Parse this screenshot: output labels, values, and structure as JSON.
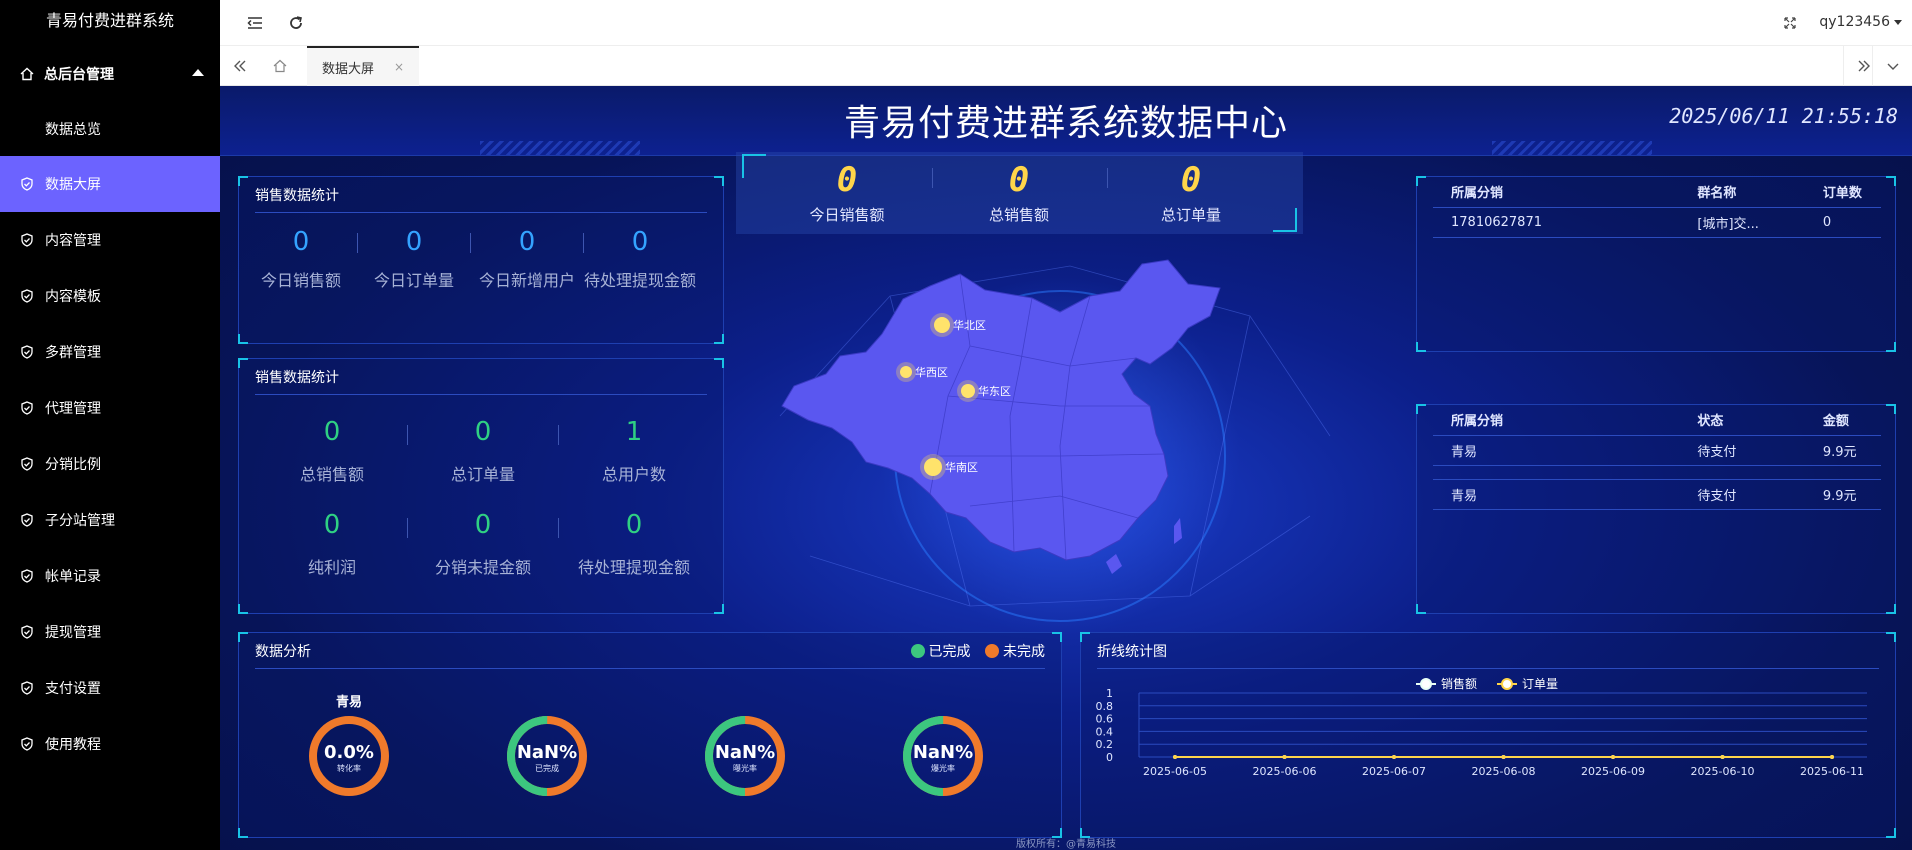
{
  "app": {
    "title": "青易付费进群系统",
    "user": "qy123456"
  },
  "sidebar": {
    "group": "总后台管理",
    "sub": "数据总览",
    "items": [
      {
        "label": "数据大屏",
        "active": true
      },
      {
        "label": "内容管理"
      },
      {
        "label": "内容模板"
      },
      {
        "label": "多群管理"
      },
      {
        "label": "代理管理"
      },
      {
        "label": "分销比例"
      },
      {
        "label": "子分站管理"
      },
      {
        "label": "帐单记录"
      },
      {
        "label": "提现管理"
      },
      {
        "label": "支付设置"
      },
      {
        "label": "使用教程"
      }
    ]
  },
  "tabs": [
    {
      "label": "数据大屏",
      "close": "×"
    }
  ],
  "dashboard": {
    "title": "青易付费进群系统数据中心",
    "datetime": "2025/06/11 21:55:18",
    "sales_panel_1": {
      "title": "销售数据统计",
      "stats": [
        {
          "value": "0",
          "label": "今日销售额"
        },
        {
          "value": "0",
          "label": "今日订单量"
        },
        {
          "value": "0",
          "label": "今日新增用户"
        },
        {
          "value": "0",
          "label": "待处理提现金额"
        }
      ]
    },
    "sales_panel_2": {
      "title": "销售数据统计",
      "stats": [
        {
          "value": "0",
          "label": "总销售额"
        },
        {
          "value": "0",
          "label": "总订单量"
        },
        {
          "value": "1",
          "label": "总用户数"
        },
        {
          "value": "0",
          "label": "纯利润"
        },
        {
          "value": "0",
          "label": "分销未提金额"
        },
        {
          "value": "0",
          "label": "待处理提现金额"
        }
      ]
    },
    "kpis": [
      {
        "value": "0",
        "label": "今日销售额"
      },
      {
        "value": "0",
        "label": "总销售额"
      },
      {
        "value": "0",
        "label": "总订单量"
      }
    ],
    "map": {
      "regions": [
        {
          "label": "华北区"
        },
        {
          "label": "华西区"
        },
        {
          "label": "华东区"
        },
        {
          "label": "华南区"
        }
      ]
    },
    "table1": {
      "headers": [
        "所属分销",
        "群名称",
        "订单数"
      ],
      "rows": [
        [
          "17810627871",
          "[城市]交...",
          "0"
        ]
      ]
    },
    "table2": {
      "headers": [
        "所属分销",
        "状态",
        "金额"
      ],
      "rows": [
        [
          "青易",
          "待支付",
          "9.9元"
        ],
        [
          "青易",
          "待支付",
          "9.9元"
        ]
      ]
    },
    "analysis": {
      "title": "数据分析",
      "legend": [
        {
          "label": "已完成",
          "color": "#3cc77f"
        },
        {
          "label": "未完成",
          "color": "#f07a2b"
        }
      ],
      "gauges": [
        {
          "top_label": "青易",
          "value": "0.0%",
          "sub": "转化率",
          "fraction": 0
        },
        {
          "top_label": "",
          "value": "NaN%",
          "sub": "已完成",
          "fraction": 0.5
        },
        {
          "top_label": "",
          "value": "NaN%",
          "sub": "曝光率",
          "fraction": 0.5
        },
        {
          "top_label": "",
          "value": "NaN%",
          "sub": "爆光率",
          "fraction": 0.5
        }
      ]
    },
    "footer": "版权所有：@青易科技"
  },
  "chart_data": {
    "type": "line",
    "title": "折线统计图",
    "x": [
      "2025-06-05",
      "2025-06-06",
      "2025-06-07",
      "2025-06-08",
      "2025-06-09",
      "2025-06-10",
      "2025-06-11"
    ],
    "series": [
      {
        "name": "销售额",
        "values": [
          0,
          0,
          0,
          0,
          0,
          0,
          0
        ],
        "color": "#e9fff6"
      },
      {
        "name": "订单量",
        "values": [
          0,
          0,
          0,
          0,
          0,
          0,
          0
        ],
        "color": "#ffd54a"
      }
    ],
    "yticks": [
      "1",
      "0.8",
      "0.6",
      "0.4",
      "0.2",
      "0"
    ],
    "ylim": [
      0,
      1
    ],
    "legend": "top-center",
    "grid": true
  }
}
